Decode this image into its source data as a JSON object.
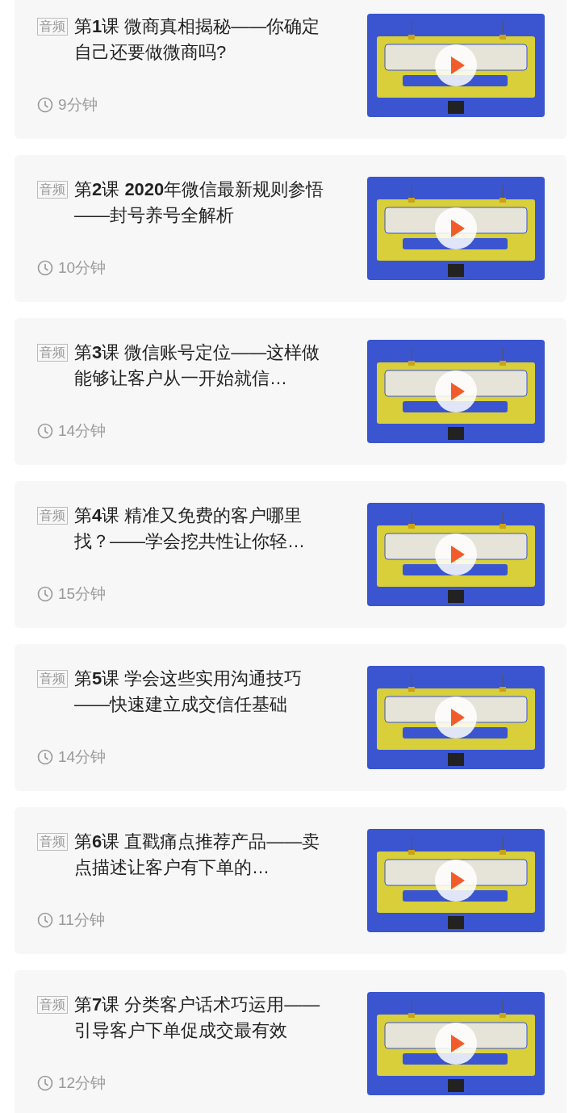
{
  "lessons": [
    {
      "tag": "音频",
      "title": "第**1**课 微商真相揭秘——你确定自己还要做微商吗?",
      "duration": "9分钟"
    },
    {
      "tag": "音频",
      "title": "第**2**课 **2020**年微信最新规则参悟——封号养号全解析",
      "duration": "10分钟"
    },
    {
      "tag": "音频",
      "title": "第**3**课 微信账号定位——这样做能够让客户从一开始就信…",
      "duration": "14分钟"
    },
    {
      "tag": "音频",
      "title": "第**4**课 精准又免费的客户哪里找？——学会挖共性让你轻…",
      "duration": "15分钟"
    },
    {
      "tag": "音频",
      "title": "第**5**课 学会这些实用沟通技巧——快速建立成交信任基础",
      "duration": "14分钟"
    },
    {
      "tag": "音频",
      "title": "第**6**课 直戳痛点推荐产品——卖点描述让客户有下单的…",
      "duration": "11分钟"
    },
    {
      "tag": "音频",
      "title": "第**7**课 分类客户话术巧运用——引导客户下单促成交最有效",
      "duration": "12分钟"
    }
  ]
}
